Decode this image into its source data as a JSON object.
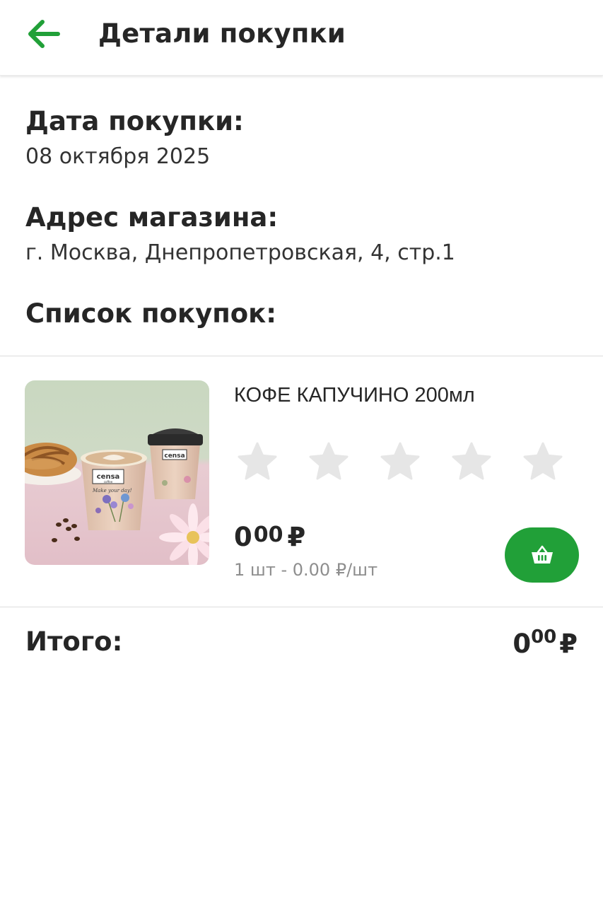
{
  "header": {
    "title": "Детали покупки",
    "back_icon": "arrow-left-icon",
    "accent_color": "#21a038"
  },
  "purchase_date": {
    "label": "Дата покупки:",
    "value": "08 октября 2025"
  },
  "store_address": {
    "label": "Адрес магазина:",
    "value": "г. Москва, Днепропетровская, 4, стр.1"
  },
  "shopping_list": {
    "label": "Список покупок:",
    "items": [
      {
        "name": "КОФЕ КАПУЧИНО 200мл",
        "image_text": {
          "brand": "censa",
          "brand_sub": "coffee",
          "slogan": "Make your day!"
        },
        "rating": {
          "max": 5,
          "value": 0
        },
        "price_int": "0",
        "price_frac": "00",
        "currency": "₽",
        "unit_line": "1 шт - 0.00 ₽/шт",
        "basket_icon": "basket-icon"
      }
    ]
  },
  "total": {
    "label": "Итого:",
    "int": "0",
    "frac": "00",
    "currency": "₽"
  }
}
